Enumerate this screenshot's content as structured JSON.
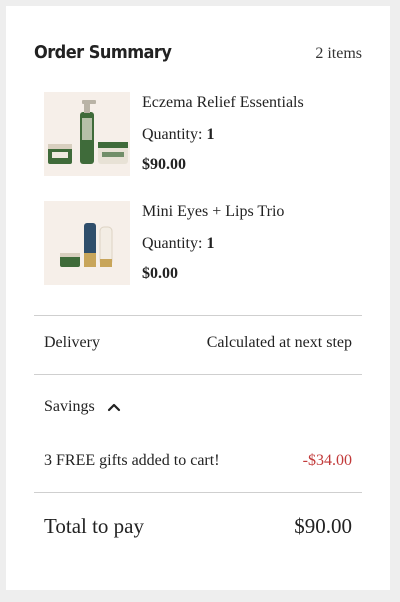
{
  "summary": {
    "title": "Order Summary",
    "count": "2 items"
  },
  "items": [
    {
      "name": "Eczema Relief Essentials",
      "qty_label": "Quantity:",
      "qty": "1",
      "price": "$90.00"
    },
    {
      "name": "Mini Eyes + Lips Trio",
      "qty_label": "Quantity:",
      "qty": "1",
      "price": "$0.00"
    }
  ],
  "delivery": {
    "label": "Delivery",
    "value": "Calculated at next step"
  },
  "savings": {
    "label": "Savings",
    "toggle_icon": "chevron-up-icon",
    "line_label": "3 FREE gifts added to cart!",
    "line_value": "-$34.00"
  },
  "total": {
    "label": "Total to pay",
    "value": "$90.00"
  },
  "colors": {
    "discount": "#c23a3a",
    "thumb_bg": "#f6efe9",
    "product_green": "#3f6b3a"
  }
}
